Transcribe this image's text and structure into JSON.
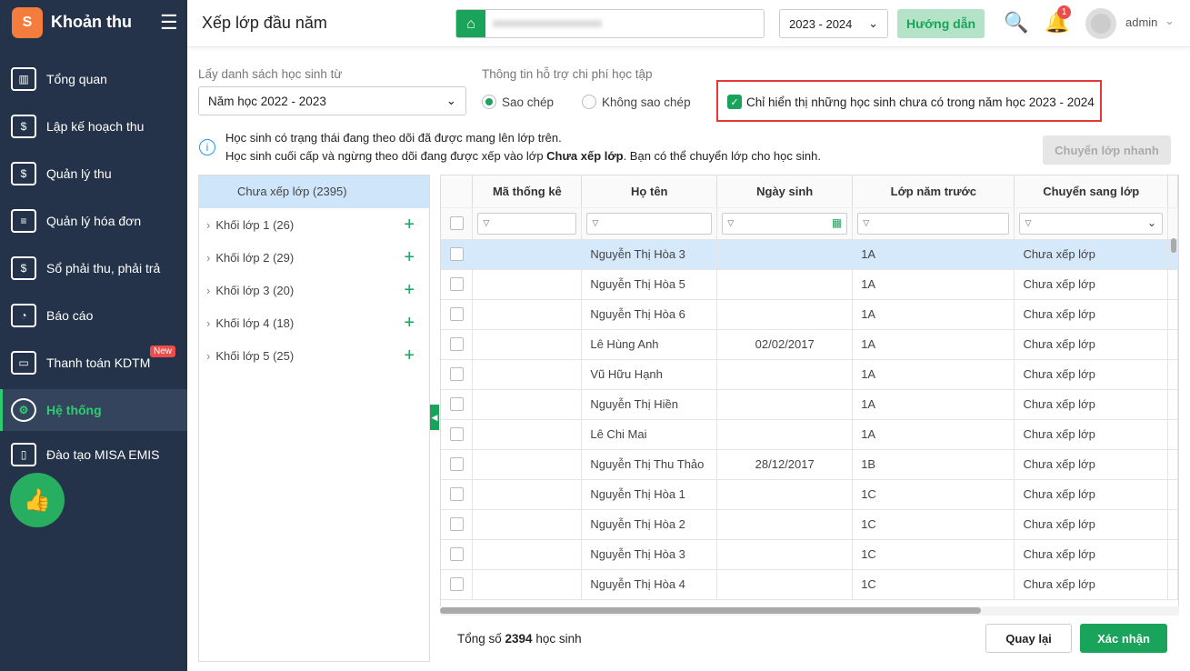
{
  "app": {
    "title": "Khoản thu",
    "logo": "S"
  },
  "sidebar": {
    "items": [
      {
        "label": "Tổng quan",
        "icon": "chart-icon"
      },
      {
        "label": "Lập kế hoạch thu",
        "icon": "calendar-dollar-icon"
      },
      {
        "label": "Quản lý thu",
        "icon": "money-hand-icon"
      },
      {
        "label": "Quản lý hóa đơn",
        "icon": "invoice-icon"
      },
      {
        "label": "Sổ phải thu, phải trả",
        "icon": "ledger-icon"
      },
      {
        "label": "Báo cáo",
        "icon": "pie-chart-icon"
      },
      {
        "label": "Thanh toán KDTM",
        "icon": "card-icon",
        "badge": "New"
      },
      {
        "label": "Hệ thống",
        "icon": "gear-icon",
        "active": true
      },
      {
        "label": "Đào tạo MISA EMIS",
        "icon": "book-icon"
      }
    ]
  },
  "header": {
    "title": "Xếp lớp đầu năm",
    "year": "2023 - 2024",
    "guide": "Hướng dẫn",
    "notifications": "1",
    "user": "admin"
  },
  "form": {
    "source_label": "Lấy danh sách học sinh từ",
    "source_value": "Năm học 2022 - 2023",
    "support_label": "Thông tin hỗ trợ chi phí học tập",
    "radio_copy": "Sao chép",
    "radio_nocopy": "Không sao chép",
    "filter_checkbox": "Chỉ hiển thị những học sinh chưa có trong năm học 2023 - 2024"
  },
  "info": {
    "line1": "Học sinh có trạng thái đang theo dõi đã được mang lên lớp trên.",
    "line2_a": "Học sinh cuối cấp và ngừng theo dõi đang được xếp vào lớp ",
    "line2_b": "Chưa xếp lớp",
    "line2_c": ". Bạn có thể chuyển lớp cho học sinh.",
    "quick": "Chuyển lớp nhanh"
  },
  "tree": {
    "root": "Chưa xếp lớp (2395)",
    "items": [
      "Khối lớp 1 (26)",
      "Khối lớp 2 (29)",
      "Khối lớp 3 (20)",
      "Khối lớp 4 (18)",
      "Khối lớp 5 (25)"
    ]
  },
  "table": {
    "headers": [
      "Mã thống kê",
      "Họ tên",
      "Ngày sinh",
      "Lớp năm trước",
      "Chuyển sang lớp"
    ],
    "rows": [
      [
        "",
        "Nguyễn Thị Hòa 3",
        "",
        "1A",
        "Chưa xếp lớp"
      ],
      [
        "",
        "Nguyễn Thị Hòa 5",
        "",
        "1A",
        "Chưa xếp lớp"
      ],
      [
        "",
        "Nguyễn Thị Hòa 6",
        "",
        "1A",
        "Chưa xếp lớp"
      ],
      [
        "",
        "Lê Hùng Anh",
        "02/02/2017",
        "1A",
        "Chưa xếp lớp"
      ],
      [
        "",
        "Vũ Hữu Hạnh",
        "",
        "1A",
        "Chưa xếp lớp"
      ],
      [
        "",
        "Nguyễn Thị Hiền",
        "",
        "1A",
        "Chưa xếp lớp"
      ],
      [
        "",
        "Lê Chi Mai",
        "",
        "1A",
        "Chưa xếp lớp"
      ],
      [
        "",
        "Nguyễn Thị Thu Thảo",
        "28/12/2017",
        "1B",
        "Chưa xếp lớp"
      ],
      [
        "",
        "Nguyễn Thị Hòa 1",
        "",
        "1C",
        "Chưa xếp lớp"
      ],
      [
        "",
        "Nguyễn Thị Hòa 2",
        "",
        "1C",
        "Chưa xếp lớp"
      ],
      [
        "",
        "Nguyễn Thị Hòa 3",
        "",
        "1C",
        "Chưa xếp lớp"
      ],
      [
        "",
        "Nguyễn Thị Hòa 4",
        "",
        "1C",
        "Chưa xếp lớp"
      ]
    ]
  },
  "footer": {
    "total_prefix": "Tổng số ",
    "total": "2394",
    "total_suffix": " học sinh",
    "back": "Quay lại",
    "confirm": "Xác nhận"
  }
}
